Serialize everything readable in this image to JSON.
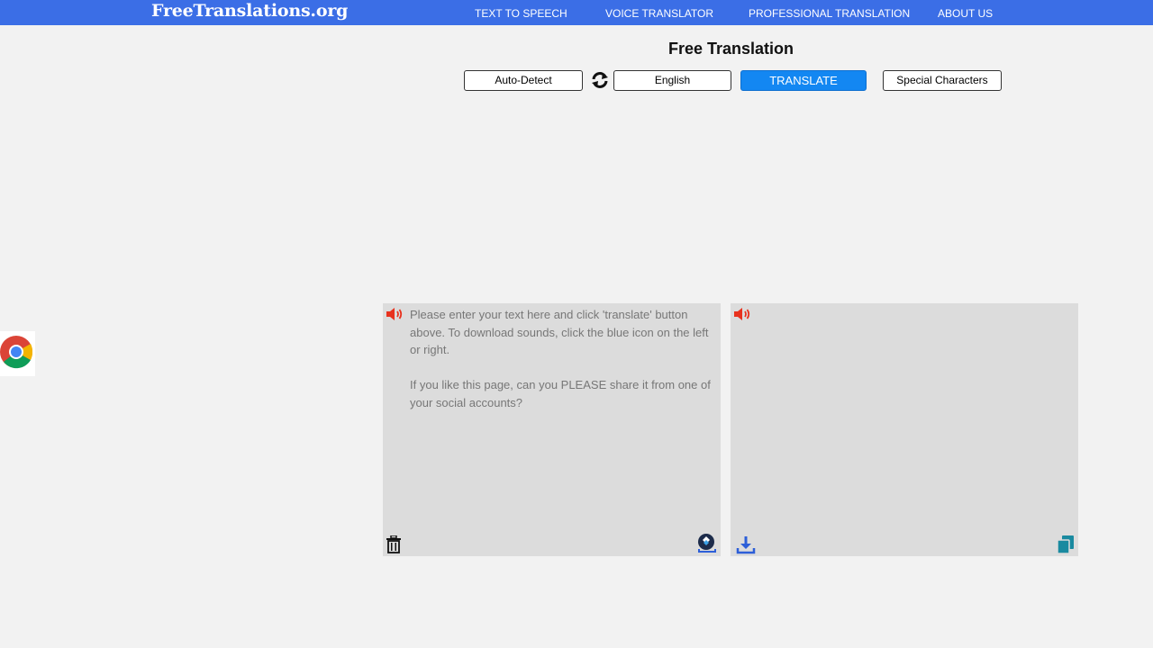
{
  "header": {
    "logo": "FreeTranslations.org",
    "nav": [
      {
        "label": "TEXT TO SPEECH"
      },
      {
        "label": "VOICE TRANSLATOR"
      },
      {
        "label": "PROFESSIONAL TRANSLATION"
      },
      {
        "label": "ABOUT US"
      }
    ]
  },
  "main": {
    "title": "Free Translation",
    "toolbar": {
      "source_language": "Auto-Detect",
      "swap_icon": "swap-arrows-icon",
      "target_language": "English",
      "translate_label": "TRANSLATE",
      "special_characters_label": "Special Characters"
    },
    "source_pane": {
      "placeholder": "Please enter your text here and click 'translate' button above. To download sounds, click the blue icon on the left or right.\n\nIf you like this page, can you PLEASE share it from one of your social accounts?",
      "icons": [
        "speaker-icon",
        "trash-icon",
        "download-app-icon"
      ]
    },
    "target_pane": {
      "text": "",
      "icons": [
        "speaker-icon",
        "download-icon",
        "copy-icon"
      ]
    }
  },
  "side": {
    "badge_icon": "chrome-logo-icon"
  },
  "colors": {
    "header_bg": "#3b6ee6",
    "translate_button": "#1387f2",
    "speaker_icon": "#e8321e",
    "download_icon": "#2d5fd8",
    "copy_icon": "#1a8aa0",
    "pane_bg": "#dcdcdc",
    "page_bg": "#f2f2f2"
  }
}
